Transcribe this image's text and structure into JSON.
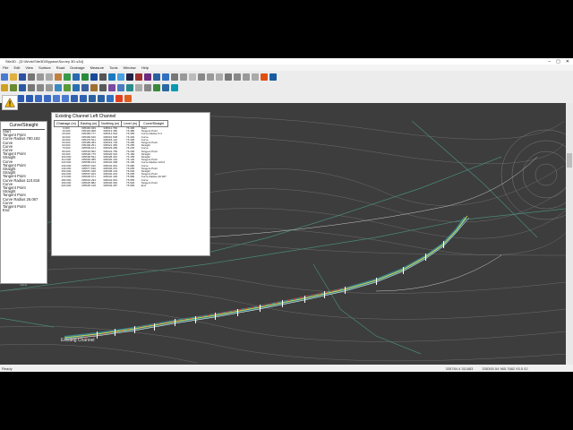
{
  "window": {
    "title": "Site3D - [D:\\Work\\Site3D\\Bypass\\Survey 3D.s3d]"
  },
  "menu": [
    "File",
    "Edit",
    "View",
    "Surface",
    "Road",
    "Drainage",
    "Measure",
    "Tools",
    "Window",
    "Help"
  ],
  "curve_panel": {
    "title": "Curve/Straight",
    "items": [
      "Start",
      "Tangent Point",
      "Curve Radius 780.182",
      "Curve",
      "Curve",
      "Curve",
      "Tangent Point",
      "Straight",
      "Curve",
      "Tangent Point",
      "Straight",
      "Straight",
      "Tangent Point",
      "Curve Radius 110.816",
      "Curve",
      "Tangent Point",
      "Straight",
      "Tangent Point",
      "Curve Radius 26.067",
      "Curve",
      "Tangent Point",
      "End"
    ]
  },
  "table": {
    "title": "Existing Channel Left Channel",
    "columns": [
      "Chainage (m)",
      "Easting (m)",
      "Northing (m)",
      "Level (m)",
      "Curve/Straight"
    ],
    "rows": [
      [
        "0.000",
        "335440.029",
        "345611.799",
        "76.406",
        "Start"
      ],
      [
        "10.000",
        "335449.908",
        "345613.382",
        "76.380",
        "Tangent Point"
      ],
      [
        "20.000",
        "335459.777",
        "345614.934",
        "76.355",
        "Curve Radius 6.3"
      ],
      [
        "30.000",
        "335469.640",
        "345616.528",
        "76.330",
        "Curve"
      ],
      [
        "40.000",
        "335479.521",
        "345618.122",
        "76.305",
        "Curve"
      ],
      [
        "50.000",
        "335489.384",
        "345619.739",
        "76.280",
        "Tangent Point"
      ],
      [
        "60.000",
        "335499.251",
        "345621.383",
        "76.255",
        "Straight"
      ],
      [
        "70.000",
        "335509.101",
        "345623.069",
        "76.230",
        "Curve"
      ],
      [
        "80.000",
        "335518.952",
        "345624.783",
        "76.205",
        "Tangent Point"
      ],
      [
        "90.000",
        "335528.775",
        "345626.532",
        "76.180",
        "Straight"
      ],
      [
        "100.000",
        "335538.591",
        "345628.342",
        "76.155",
        "Straight"
      ],
      [
        "110.000",
        "335548.385",
        "345630.194",
        "76.130",
        "Tangent Point"
      ],
      [
        "120.000",
        "335558.163",
        "345632.098",
        "76.105",
        "Curve Radius 120.0"
      ],
      [
        "130.000",
        "335567.910",
        "345634.061",
        "76.080",
        "Curve"
      ],
      [
        "140.000",
        "335577.639",
        "345636.076",
        "76.055",
        "Tangent Point"
      ],
      [
        "150.000",
        "335587.348",
        "345638.133",
        "76.030",
        "Straight"
      ],
      [
        "160.000",
        "335597.023",
        "345640.243",
        "76.005",
        "Tangent Point"
      ],
      [
        "170.000",
        "335606.671",
        "345642.418",
        "75.980",
        "Curve Radius 26.067"
      ],
      [
        "180.000",
        "335616.294",
        "345644.643",
        "75.955",
        "Curve"
      ],
      [
        "190.000",
        "335625.882",
        "345646.932",
        "75.930",
        "Tangent Point"
      ],
      [
        "200.000",
        "335635.418",
        "345649.287",
        "75.905",
        "End"
      ]
    ]
  },
  "canvas": {
    "channel_label": "Existing Channel",
    "label_501": "501"
  },
  "status": {
    "left": "Ready",
    "mid": "335784.4  311883",
    "right": "335300.54 965.7682 93.5 02"
  }
}
